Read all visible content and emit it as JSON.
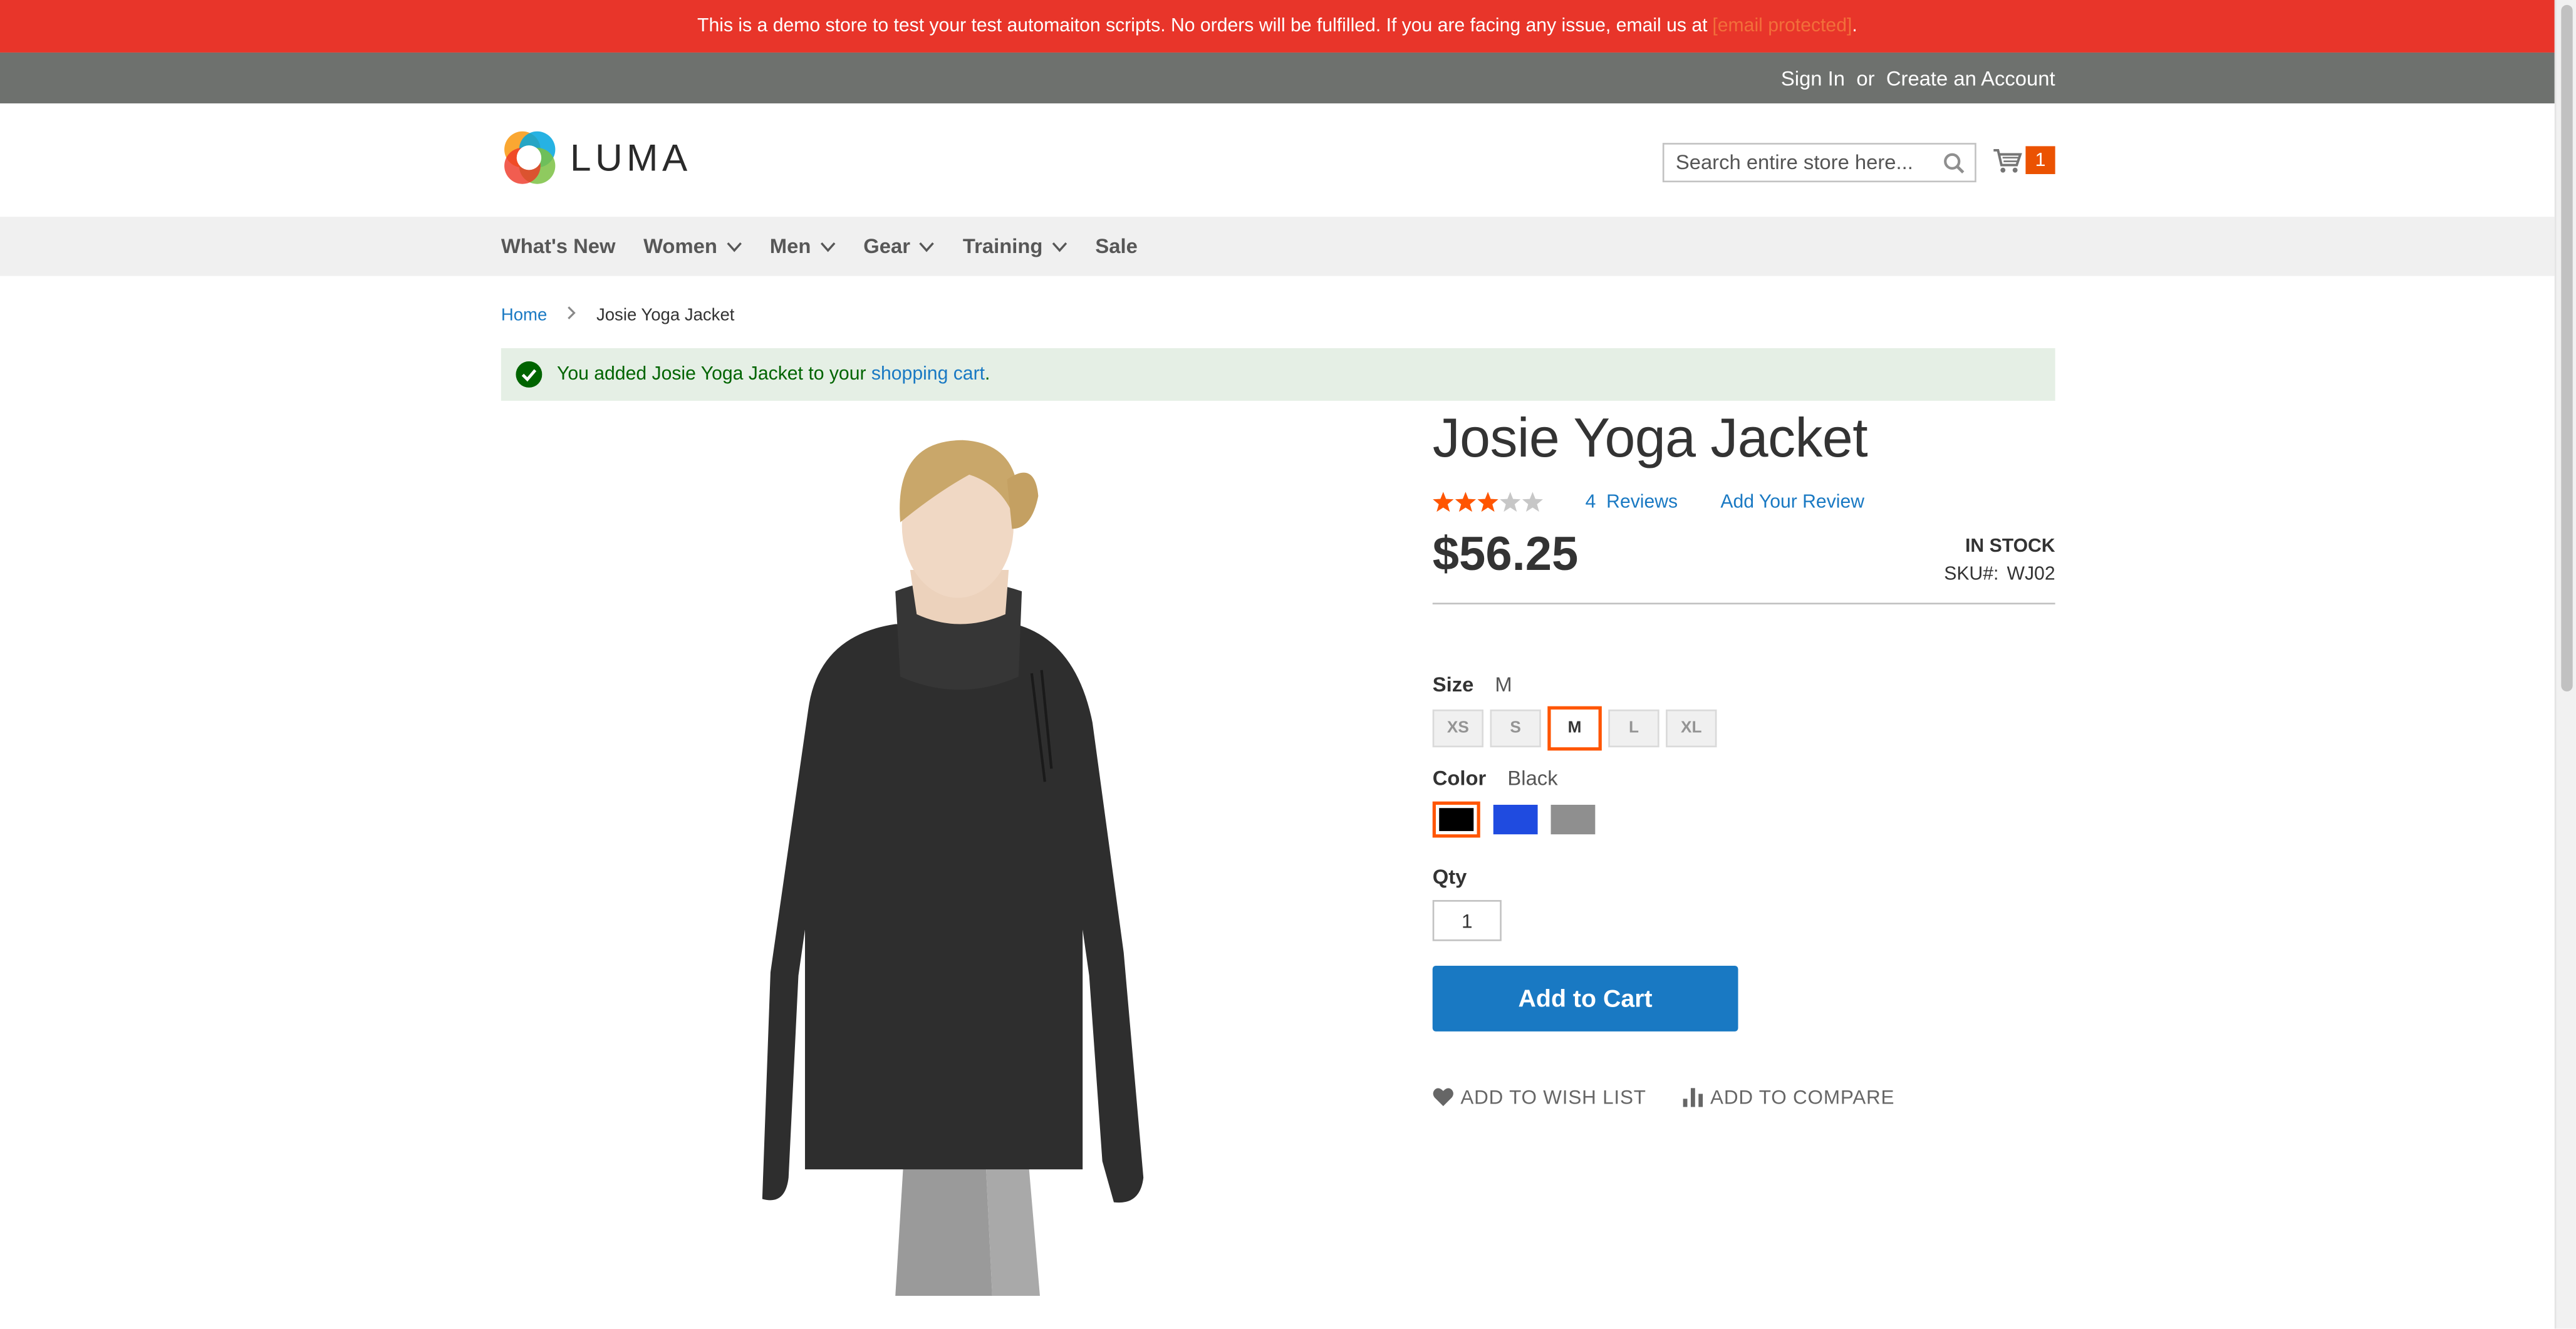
{
  "demo_banner": {
    "text": "This is a demo store to test your test automaiton scripts. No orders will be fulfilled. If you are facing any issue, email us at",
    "email": "[email protected]",
    "suffix": "."
  },
  "top_links": {
    "sign_in": "Sign In",
    "or": "or",
    "create_account": "Create an Account"
  },
  "header": {
    "logo_text": "LUMA",
    "search_placeholder": "Search entire store here...",
    "cart_count": "1"
  },
  "nav": {
    "items": [
      {
        "label": "What's New"
      },
      {
        "label": "Women"
      },
      {
        "label": "Men"
      },
      {
        "label": "Gear"
      },
      {
        "label": "Training"
      },
      {
        "label": "Sale"
      }
    ]
  },
  "breadcrumb": {
    "home": "Home",
    "current": "Josie Yoga Jacket"
  },
  "message": {
    "prefix": "You added Josie Yoga Jacket to your",
    "link": "shopping cart",
    "suffix": "."
  },
  "product": {
    "title": "Josie Yoga Jacket",
    "rating_fraction": 0.6,
    "reviews_count": "4",
    "reviews_label": "Reviews",
    "add_review": "Add Your Review",
    "price": "$56.25",
    "stock": "IN STOCK",
    "sku_label": "SKU#:",
    "sku": "WJ02",
    "size_label": "Size",
    "size_selected": "M",
    "sizes": [
      "XS",
      "S",
      "M",
      "L",
      "XL"
    ],
    "color_label": "Color",
    "color_selected": "Black",
    "colors": [
      {
        "name": "Black",
        "hex": "#000000"
      },
      {
        "name": "Blue",
        "hex": "#1f4be0"
      },
      {
        "name": "Gray",
        "hex": "#8f8f8f"
      }
    ],
    "qty_label": "Qty",
    "qty": "1",
    "add_to_cart": "Add to Cart",
    "wish_list": "ADD TO WISH LIST",
    "compare": "ADD TO COMPARE"
  },
  "colors": {
    "accent": "#1979c3",
    "banner": "#e8352a",
    "orange": "#eb5202",
    "star": "#ff5501"
  }
}
